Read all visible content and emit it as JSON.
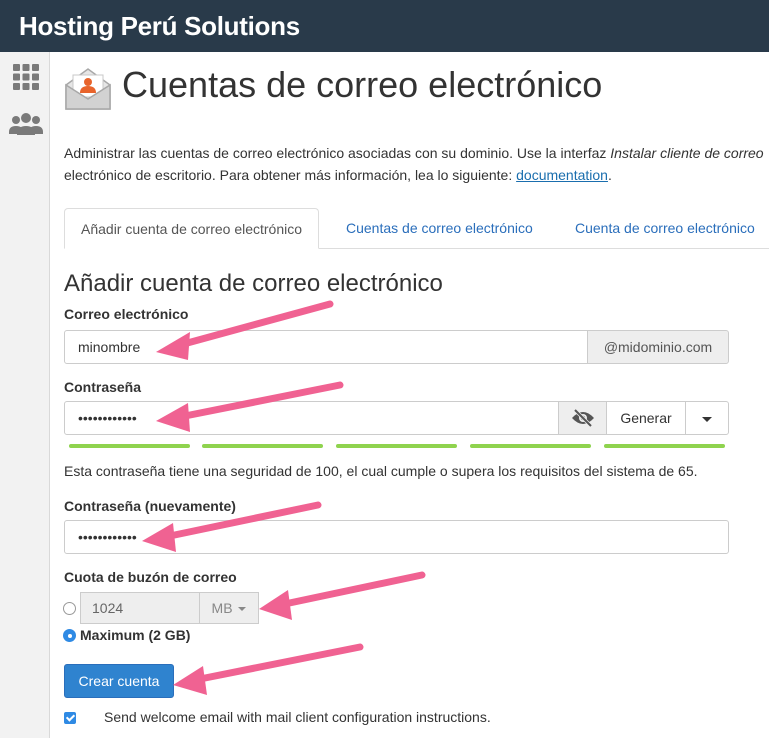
{
  "header": {
    "brand": "Hosting Perú Solutions"
  },
  "sidebar": {
    "icons": [
      "apps-grid-icon",
      "users-icon"
    ]
  },
  "page": {
    "title": "Cuentas de correo electrónico",
    "description_part1": "Administrar las cuentas de correo electrónico asociadas con su dominio. Use la interfaz ",
    "description_em": "Instalar cliente de correo",
    "description_part2": "electrónico de escritorio. Para obtener más información, lea lo siguiente: ",
    "description_link": "documentation",
    "description_end": "."
  },
  "tabs": [
    {
      "label": "Añadir cuenta de correo electrónico",
      "active": true
    },
    {
      "label": "Cuentas de correo electrónico",
      "active": false
    },
    {
      "label": "Cuenta de correo electrónico",
      "active": false
    }
  ],
  "form": {
    "section_title": "Añadir cuenta de correo electrónico",
    "email": {
      "label": "Correo electrónico",
      "value": "minombre",
      "domain": "@midominio.com"
    },
    "password": {
      "label": "Contraseña",
      "value": "••••••••••••",
      "generate_label": "Generar",
      "strength_segments": 5,
      "strength_color": "#8fd34e"
    },
    "strength_help": "Esta contraseña tiene una seguridad de 100, el cual cumple o supera los requisitos del sistema de 65.",
    "password_again": {
      "label": "Contraseña (nuevamente)",
      "value": "••••••••••••"
    },
    "quota": {
      "label": "Cuota de buzón de correo",
      "value": "1024",
      "unit": "MB",
      "max_label": "Maximum (2 GB)",
      "selected": "maximum"
    },
    "submit_label": "Crear cuenta",
    "welcome_checkbox": {
      "label": "Send welcome email with mail client configuration instructions.",
      "checked": true
    }
  },
  "colors": {
    "topbar": "#293a4a",
    "accent": "#2f83cf",
    "link": "#2a6ebb",
    "annotation_arrow": "#f06292"
  }
}
